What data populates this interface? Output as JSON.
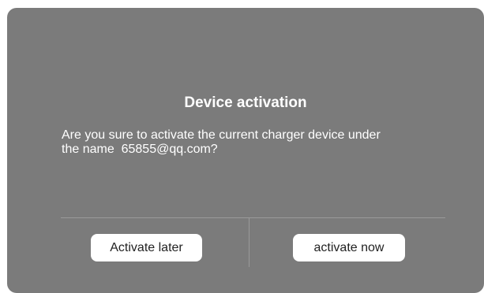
{
  "dialog": {
    "title": "Device activation",
    "message_line1": "Are you sure to activate the current charger device under",
    "message_line2": "the name  65855@qq.com?",
    "buttons": {
      "later_label": "Activate later",
      "now_label": "activate now"
    }
  },
  "colors": {
    "dialog_background": "#7b7b7b",
    "text": "#ffffff",
    "button_background": "#ffffff",
    "divider": "#9a9a9a"
  }
}
